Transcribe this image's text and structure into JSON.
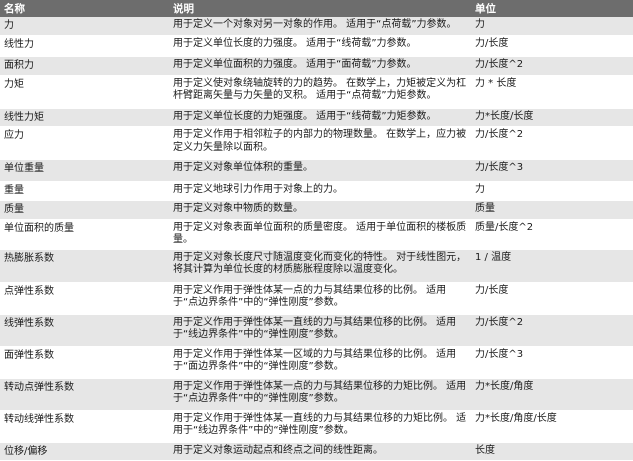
{
  "table": {
    "headers": [
      "名称",
      "说明",
      "单位"
    ],
    "rows": [
      {
        "name": "力",
        "desc": "用于定义一个对象对另一对象的作用。 适用于“点荷载”力参数。",
        "unit": "力"
      },
      {
        "name": "线性力",
        "desc": "用于定义单位长度的力强度。 适用于“线荷载”力参数。",
        "unit": "力/长度"
      },
      {
        "name": "面积力",
        "desc": "用于定义单位面积的力强度。 适用于“面荷载”力参数。",
        "unit": "力/长度^2"
      },
      {
        "name": "力矩",
        "desc": "用于定义使对象绕轴旋转的力的趋势。 在数学上，力矩被定义为杠杆臂距离矢量与力矢量的叉积。 适用于“点荷载”力矩参数。",
        "unit": "力 * 长度"
      },
      {
        "name": "线性力矩",
        "desc": "用于定义单位长度的力矩强度。 适用于“线荷载”力矩参数。",
        "unit": "力*长度/长度"
      },
      {
        "name": "应力",
        "desc": "用于定义作用于相邻粒子的内部力的物理数量。 在数学上，应力被定义力矢量除以面积。",
        "unit": "力/长度^2"
      },
      {
        "name": "单位重量",
        "desc": "用于定义对象单位体积的重量。",
        "unit": "力/长度^3"
      },
      {
        "name": "重量",
        "desc": "用于定义地球引力作用于对象上的力。",
        "unit": "力"
      },
      {
        "name": "质量",
        "desc": "用于定义对象中物质的数量。",
        "unit": "质量"
      },
      {
        "name": "单位面积的质量",
        "desc": "用于定义对象表面单位面积的质量密度。 适用于单位面积的楼板质量。",
        "unit": "质量/长度^2"
      },
      {
        "name": "热膨胀系数",
        "desc": "用于定义对象长度尺寸随温度变化而变化的特性。 对于线性图元，将其计算为单位长度的材质膨胀程度除以温度变化。",
        "unit": "1 / 温度"
      },
      {
        "name": "点弹性系数",
        "desc": "用于定义作用于弹性体某一点的力与其结果位移的比例。 适用于“点边界条件”中的“弹性刚度”参数。",
        "unit": "力/长度"
      },
      {
        "name": "线弹性系数",
        "desc": "用于定义作用于弹性体某一直线的力与其结果位移的比例。 适用于“线边界条件”中的“弹性刚度”参数。",
        "unit": "力/长度^2"
      },
      {
        "name": "面弹性系数",
        "desc": "用于定义作用于弹性体某一区域的力与其结果位移的比例。 适用于“面边界条件”中的“弹性刚度”参数。",
        "unit": "力/长度^3"
      },
      {
        "name": "转动点弹性系数",
        "desc": "用于定义作用于弹性体某一点的力与其结果位移的力矩比例。 适用于“点边界条件”中的“弹性刚度”参数。",
        "unit": "力*长度/角度"
      },
      {
        "name": "转动线弹性系数",
        "desc": "用于定义作用于弹性体某一直线的力与其结果位移的力矩比例。 适用于“线边界条件”中的“弹性刚度”参数。",
        "unit": "力*长度/角度/长度"
      },
      {
        "name": "位移/偏移",
        "desc": "用于定义对象运动起点和终点之间的线性距离。",
        "unit": "长度"
      }
    ]
  }
}
